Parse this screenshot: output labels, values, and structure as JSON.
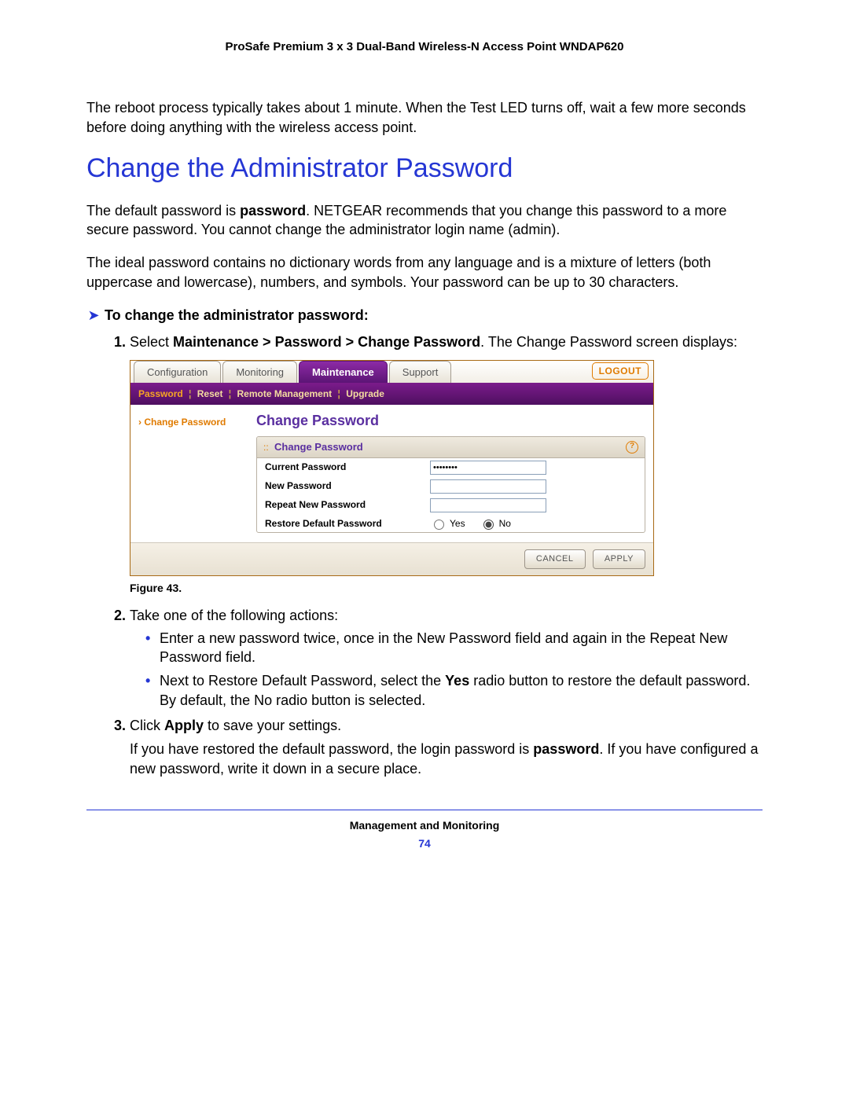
{
  "header": {
    "title": "ProSafe Premium 3 x 3 Dual-Band Wireless-N Access Point WNDAP620"
  },
  "intro_para": "The reboot process typically takes about 1 minute. When the Test LED turns off, wait a few more seconds before doing anything with the wireless access point.",
  "section_heading": "Change the Administrator Password",
  "para1_a": "The default password is ",
  "para1_bold": "password",
  "para1_b": ". NETGEAR recommends that you change this password to a more secure password. You cannot change the administrator login name (admin).",
  "para2": "The ideal password contains no dictionary words from any language and is a mixture of letters (both uppercase and lowercase), numbers, and symbols. Your password can be up to 30 characters.",
  "proc_heading": "To change the administrator password:",
  "step1_a": "Select ",
  "step1_bold": "Maintenance > Password > Change Password",
  "step1_b": ". The Change Password screen displays:",
  "figure_caption": "Figure 43.",
  "step2_lead": "Take one of the following actions:",
  "bullet1": "Enter a new password twice, once in the New Password field and again in the Repeat New Password field.",
  "bullet2_a": "Next to Restore Default Password, select the ",
  "bullet2_bold": "Yes",
  "bullet2_b": " radio button to restore the default password. By default, the No radio button is selected.",
  "step3_a": "Click ",
  "step3_bold": "Apply",
  "step3_b": " to save your settings.",
  "step3_para_a": "If you have restored the default password, the login password is ",
  "step3_para_bold": "password",
  "step3_para_b": ". If you have configured a new password, write it down in a secure place.",
  "footer": {
    "section": "Management and Monitoring",
    "page": "74"
  },
  "shot": {
    "tabs": [
      "Configuration",
      "Monitoring",
      "Maintenance",
      "Support"
    ],
    "active_tab_index": 2,
    "logout": "LOGOUT",
    "purple_items": [
      "Password",
      "Reset",
      "Remote Management",
      "Upgrade"
    ],
    "purple_active_index": 0,
    "side_item": "Change Password",
    "panel_title": "Change Password",
    "panel_head": "Change Password",
    "rows": {
      "current": "Current Password",
      "new": "New Password",
      "repeat": "Repeat New Password",
      "restore": "Restore Default Password",
      "yes": "Yes",
      "no": "No"
    },
    "current_value": "••••••••",
    "buttons": {
      "cancel": "CANCEL",
      "apply": "APPLY"
    },
    "help": "?"
  }
}
